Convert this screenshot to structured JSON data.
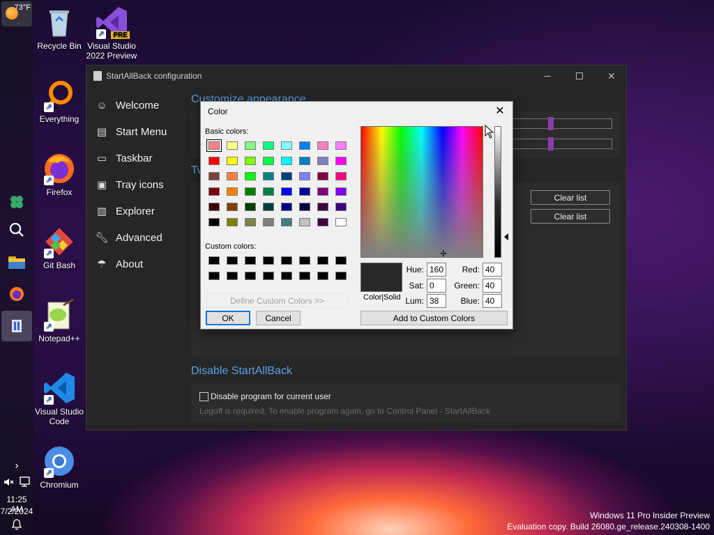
{
  "desktop": {
    "icons": [
      {
        "label": "Recycle Bin"
      },
      {
        "label": "Visual Studio 2022 Preview",
        "badge": "PRE"
      },
      {
        "label": "Everything"
      },
      {
        "label": "Firefox"
      },
      {
        "label": "Git Bash"
      },
      {
        "label": "Notepad++"
      },
      {
        "label": "Visual Studio Code"
      },
      {
        "label": "Chromium"
      }
    ],
    "watermark_line1": "Windows 11 Pro Insider Preview",
    "watermark_line2": "Evaluation copy. Build 26080.ge_release.240308-1400"
  },
  "taskbar": {
    "weather_temp": "73°F",
    "clock_time": "11:25 AM",
    "clock_date": "7/2/2024",
    "expand_glyph": "›"
  },
  "sab_window": {
    "title": "StartAllBack configuration",
    "nav": [
      {
        "label": "Welcome",
        "icon": "smile-icon"
      },
      {
        "label": "Start Menu",
        "icon": "start-menu-icon"
      },
      {
        "label": "Taskbar",
        "icon": "taskbar-icon"
      },
      {
        "label": "Tray icons",
        "icon": "tray-icon"
      },
      {
        "label": "Explorer",
        "icon": "folder-icon"
      },
      {
        "label": "Advanced",
        "icon": "wrench-icon"
      },
      {
        "label": "About",
        "icon": "umbrella-icon"
      }
    ],
    "heading_customize": "Customize appearance",
    "heading_tweaks_partial": "Tw",
    "clear_list_1": "Clear list",
    "clear_list_2": "Clear list",
    "heading_disable": "Disable StartAllBack",
    "disable_checkbox_label": "Disable program for current user",
    "disable_note": "Logoff is required. To enable program again, go to Control Panel - StartAllBack"
  },
  "color_dialog": {
    "title": "Color",
    "basic_colors_label": "Basic colors:",
    "basic_colors": [
      "#ff8080",
      "#ffff80",
      "#80ff80",
      "#00ff80",
      "#80ffff",
      "#0080ff",
      "#ff80c0",
      "#ff80ff",
      "#ff0000",
      "#ffff00",
      "#80ff00",
      "#00ff40",
      "#00ffff",
      "#0080c0",
      "#8080c0",
      "#ff00ff",
      "#804040",
      "#ff8040",
      "#00ff00",
      "#008080",
      "#004080",
      "#8080ff",
      "#800040",
      "#ff0080",
      "#800000",
      "#ff8000",
      "#008000",
      "#008040",
      "#0000ff",
      "#0000a0",
      "#800080",
      "#8000ff",
      "#400000",
      "#804000",
      "#004000",
      "#004040",
      "#000080",
      "#000040",
      "#400040",
      "#400080",
      "#000000",
      "#808000",
      "#808040",
      "#808080",
      "#408080",
      "#c0c0c0",
      "#400040",
      "#ffffff"
    ],
    "custom_colors_label": "Custom colors:",
    "custom_colors": [
      "#000000",
      "#000000",
      "#000000",
      "#000000",
      "#000000",
      "#000000",
      "#000000",
      "#000000",
      "#000000",
      "#000000",
      "#000000",
      "#000000",
      "#000000",
      "#000000",
      "#000000",
      "#000000"
    ],
    "define_custom_button": "Define Custom Colors >>",
    "ok_button": "OK",
    "cancel_button": "Cancel",
    "color_solid_label": "Color|Solid",
    "hue_label": "Hue:",
    "hue": "160",
    "sat_label": "Sat:",
    "sat": "0",
    "lum_label": "Lum:",
    "lum": "38",
    "red_label": "Red:",
    "red": "40",
    "green_label": "Green:",
    "green": "40",
    "blue_label": "Blue:",
    "blue": "40",
    "add_custom_button": "Add to Custom Colors",
    "preview_color": "#282828"
  }
}
